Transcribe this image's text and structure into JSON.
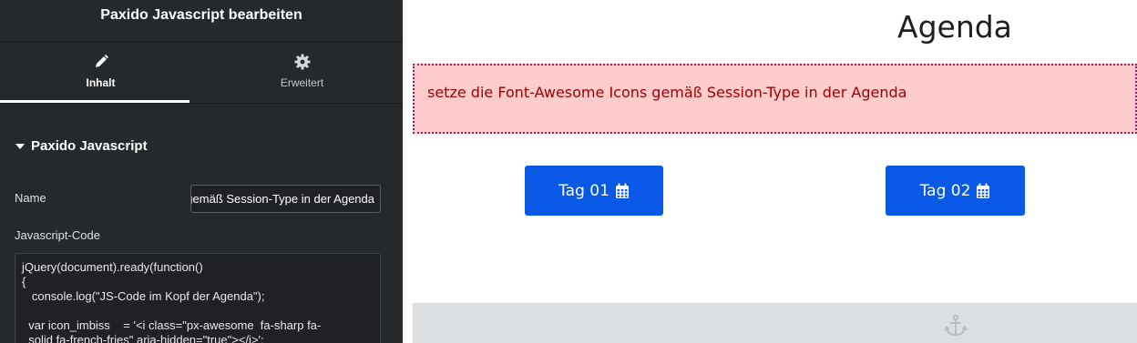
{
  "panel": {
    "title": "Paxido Javascript bearbeiten",
    "tabs": [
      {
        "label": "Inhalt",
        "icon": "pencil-icon",
        "active": true
      },
      {
        "label": "Erweitert",
        "icon": "gear-icon",
        "active": false
      }
    ],
    "section": {
      "title": "Paxido Javascript"
    },
    "name_field": {
      "label": "Name",
      "value": "setze die Font-Awesome Icons gemäß Session-Type in der Agenda"
    },
    "code_field": {
      "label": "Javascript-Code",
      "value": "jQuery(document).ready(function()\n{\n   console.log(\"JS-Code im Kopf der Agenda\");\n\n  var icon_imbiss    = '<i class=\"px-awesome  fa-sharp fa-\n  solid fa-french-fries\" aria-hidden=\"true\"></i>';"
    }
  },
  "preview": {
    "title": "Agenda",
    "alert_text": "setze die Font-Awesome Icons gemäß Session-Type in der Agenda",
    "buttons": [
      {
        "label": "Tag 01",
        "icon": "calendar-icon"
      },
      {
        "label": "Tag 02",
        "icon": "calendar-icon"
      }
    ],
    "footer_icon": "anchor-icon"
  },
  "colors": {
    "panel_bg": "#26292c",
    "alert_bg": "#ffcccc",
    "alert_text": "#a00000",
    "alert_border": "#a5196b",
    "button_bg": "#0a59e6"
  }
}
